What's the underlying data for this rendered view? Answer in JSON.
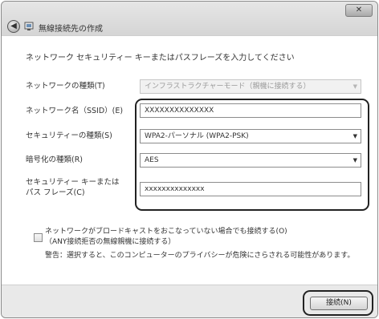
{
  "window": {
    "title": "無線接続先の作成",
    "close_label": "✕"
  },
  "content": {
    "instruction": "ネットワーク セキュリティー キーまたはパスフレーズを入力してください"
  },
  "fields": [
    {
      "label": "ネットワークの種類(T)",
      "value": "インフラストラクチャーモード（親機に接続する）",
      "disabled": true,
      "dropdown": true
    },
    {
      "label": "ネットワーク名（SSID）(E)",
      "value": "XXXXXXXXXXXXXX",
      "disabled": false,
      "dropdown": false
    },
    {
      "label": "セキュリティーの種類(S)",
      "value": "WPA2-パーソナル (WPA2-PSK)",
      "disabled": false,
      "dropdown": true
    },
    {
      "label": "暗号化の種類(R)",
      "value": "AES",
      "disabled": false,
      "dropdown": true
    },
    {
      "label_line1": "セキュリティー キーまたは",
      "label_line2": "パス フレーズ(C)",
      "value": "xxxxxxxxxxxxxx",
      "disabled": false,
      "dropdown": false
    }
  ],
  "option": {
    "line1": "ネットワークがブロードキャストをおこなっていない場合でも接続する(O)",
    "line2": "（ANY接続拒否の無線親機に接続する）",
    "warning": "警告：選択すると、このコンピューターのプライバシーが危険にさらされる可能性があります。",
    "checked": false
  },
  "footer": {
    "connect_label": "接続(N)"
  },
  "icons": [
    "back-arrow-icon",
    "network-icon",
    "close-icon",
    "dropdown-caret-icon"
  ]
}
